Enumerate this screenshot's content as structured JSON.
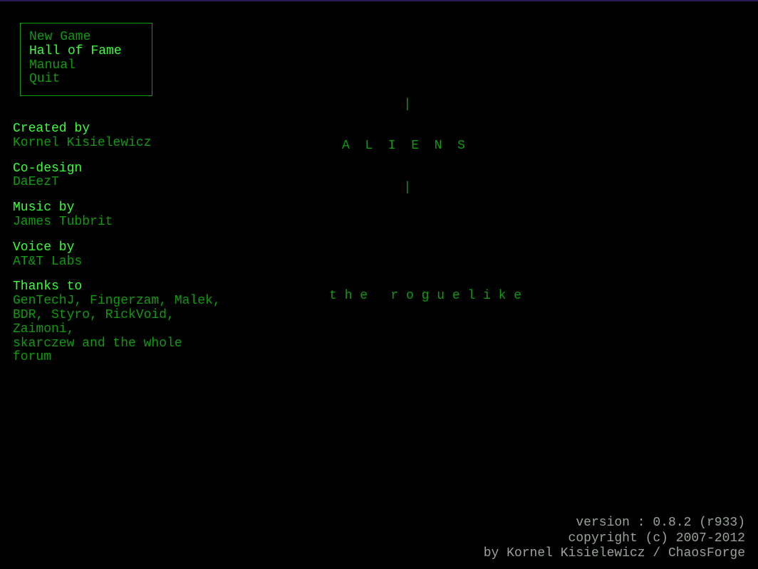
{
  "menu": {
    "items": [
      {
        "label": "New Game",
        "selected": false
      },
      {
        "label": "Hall of Fame",
        "selected": true
      },
      {
        "label": "Manual",
        "selected": false
      },
      {
        "label": "Quit",
        "selected": false
      }
    ]
  },
  "credits": {
    "created_by": {
      "label": "Created by",
      "value": "Kornel Kisielewicz"
    },
    "co_design": {
      "label": "Co-design",
      "value": "DaEezT"
    },
    "music_by": {
      "label": "Music by",
      "value": "James Tubbrit"
    },
    "voice_by": {
      "label": "Voice by",
      "value": "AT&T Labs"
    },
    "thanks_to": {
      "label": "Thanks to",
      "line1": "GenTechJ, Fingerzam, Malek,",
      "line2": "BDR, Styro, RickVoid, Zaimoni,",
      "line3": "skarczew and the whole forum"
    }
  },
  "title": {
    "pipe": "        |",
    "aliens": "A  L  I  E  N  S",
    "subtitle": "t h e   r o g u e l i k e"
  },
  "footer": {
    "version": "version : 0.8.2 (r933)",
    "copyright": "copyright (c) 2007-2012",
    "by": "by Kornel Kisielewicz / ChaosForge"
  }
}
